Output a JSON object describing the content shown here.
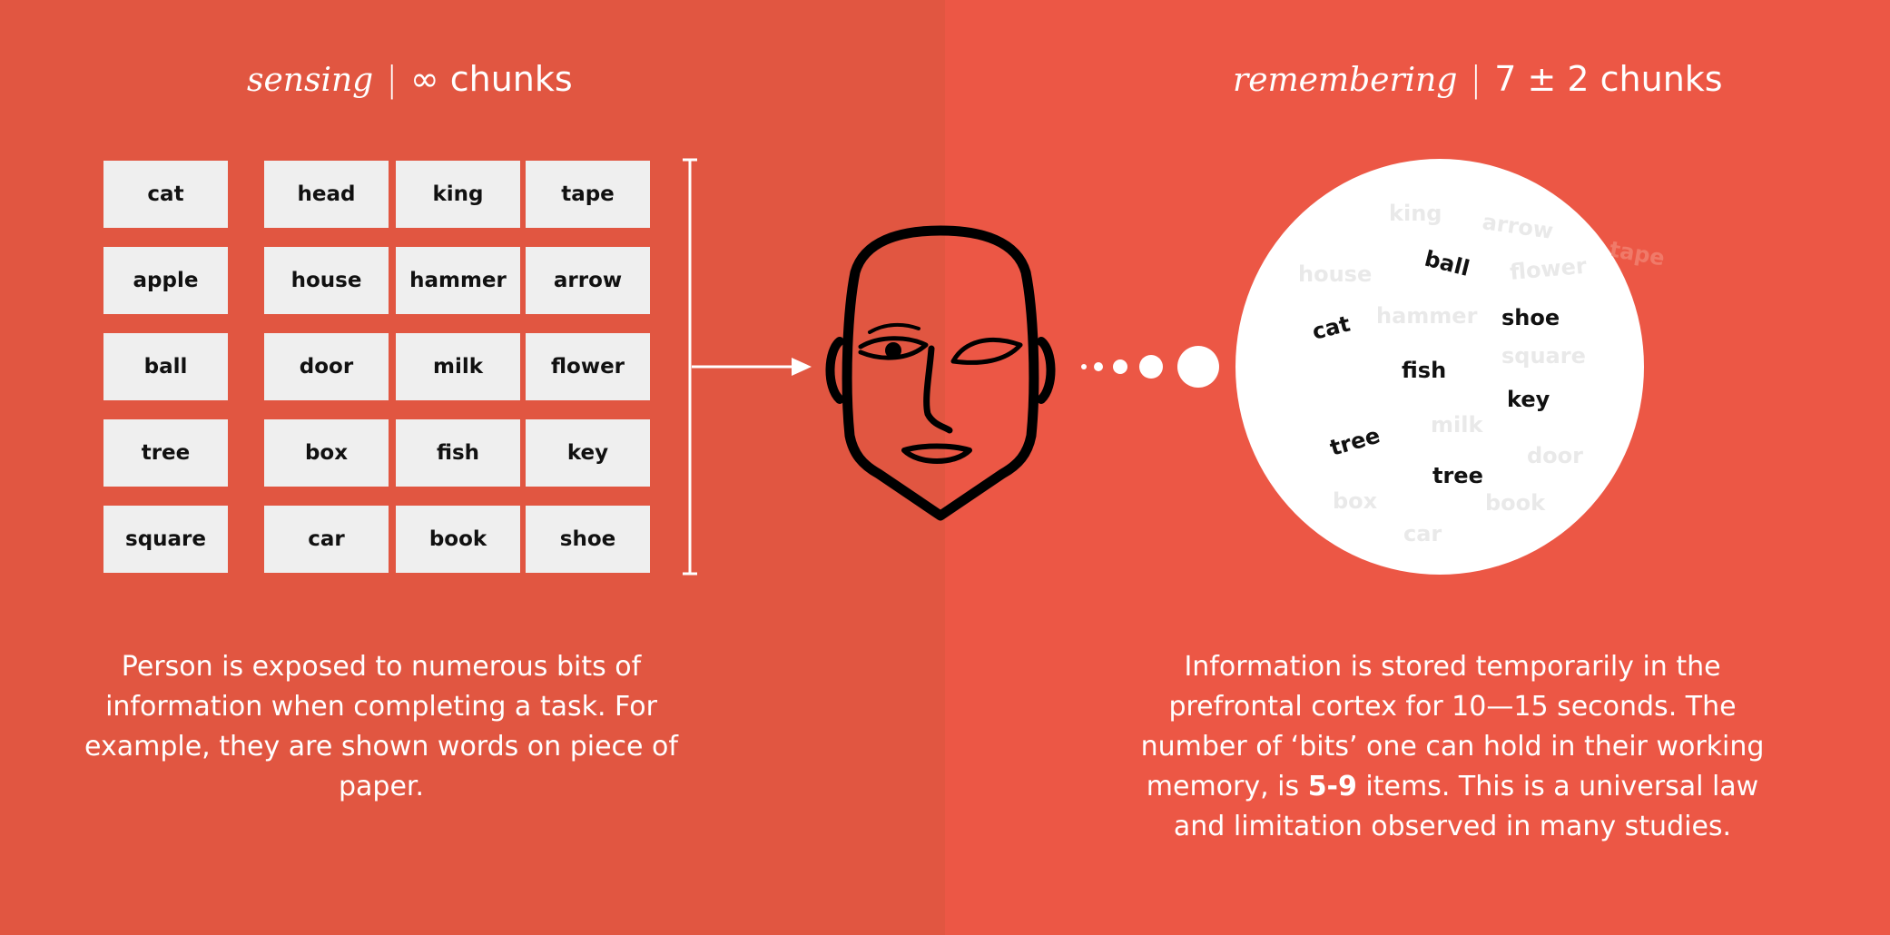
{
  "sensing": {
    "title_italic": "sensing",
    "separator": "|",
    "title_rest": "∞ chunks",
    "words": [
      "cat",
      "head",
      "king",
      "tape",
      "apple",
      "house",
      "hammer",
      "arrow",
      "ball",
      "door",
      "milk",
      "flower",
      "tree",
      "box",
      "fish",
      "key",
      "square",
      "car",
      "book",
      "shoe"
    ],
    "description": "Person is exposed to numerous bits of information when completing a task. For example, they are shown words on piece of paper."
  },
  "remembering": {
    "title_italic": "remembering",
    "separator": "|",
    "title_rest": "7 ± 2 chunks",
    "faded_words": [
      "king",
      "arrow",
      "tape",
      "house",
      "flower",
      "hammer",
      "square",
      "milk",
      "door",
      "box",
      "book",
      "car"
    ],
    "kept_words": [
      "ball",
      "cat",
      "shoe",
      "fish",
      "key",
      "tree",
      "tree"
    ],
    "description_before": "Information is stored temporarily in the prefrontal cortex for 10—15 seconds. The number of ‘bits’ one can hold in their working memory, is ",
    "description_bold": "5-9",
    "description_after": " items. This is a universal law and limitation observed in many studies."
  },
  "colors": {
    "left_background": "#E15641",
    "right_background": "#EC5745",
    "card": "#efefef",
    "bubble": "#ffffff",
    "ink": "#111111"
  },
  "icons": [
    "bracket-icon",
    "arrow-icon",
    "face-icon",
    "thought-dots-icon",
    "thought-bubble-icon"
  ]
}
